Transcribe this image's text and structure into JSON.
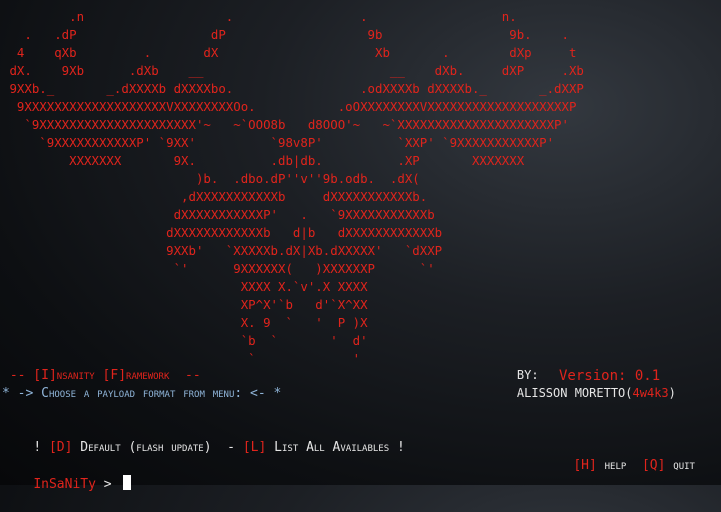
{
  "banner": {
    "art_lines": [
      "         .n                   .                 .                  n.",
      "   .   .dP                  dP                   9b                 9b.    .",
      "  4    qXb         .       dX                     Xb       .        dXp     t",
      " dX.    9Xb      .dXb    __                         __    dXb.     dXP     .Xb",
      " 9XXb._       _.dXXXXb dXXXXbo.                 .odXXXXb dXXXXb._       _.dXXP",
      "  9XXXXXXXXXXXXXXXXXXXVXXXXXXXXOo.           .oOXXXXXXXXVXXXXXXXXXXXXXXXXXXXP",
      "   `9XXXXXXXXXXXXXXXXXXXXX'~   ~`OOO8b   d8OOO'~   ~`XXXXXXXXXXXXXXXXXXXXXP'",
      "     `9XXXXXXXXXXXP' `9XX'          `98v8P'          `XXP' `9XXXXXXXXXXXP'",
      "         XXXXXXX       9X.          .db|db.          .XP       XXXXXXX",
      "                          )b.  .dbo.dP''v''9b.odb.  .dX(",
      "                        ,dXXXXXXXXXXXb     dXXXXXXXXXXXb.",
      "                       dXXXXXXXXXXXP'   .   `9XXXXXXXXXXXb",
      "                      dXXXXXXXXXXXXb   d|b   dXXXXXXXXXXXXb",
      "                      9XXb'   `XXXXXb.dX|Xb.dXXXXX'   `dXXP",
      "                       `'      9XXXXXX(   )XXXXXXP      `'",
      "                                XXXX X.`v'.X XXXX",
      "                                XP^X'`b   d'`X^XX",
      "                                X. 9  `   '  P )X",
      "                                `b  `       '  d'",
      "                                 `             '"
    ],
    "author_prefix": "BY:",
    "author_name": "ALISSON MORETTO",
    "author_paren_open": "(",
    "author_handle": "4w4k3",
    "author_paren_close": ")",
    "version": "Version: 0.1"
  },
  "framework_title": " -- [I]nsanity [F]ramework  --",
  "menu": {
    "prompt_line": "* -> Choose a payload format from menu: <- *",
    "options_prefix": "! ",
    "opt_default_key": "[D]",
    "opt_default_label": " Default (flash update)",
    "separator": "  - ",
    "opt_list_key": "[L]",
    "opt_list_label": " List All Availables !",
    "help_key": "[H]",
    "help_label": " help",
    "quit_key": "[Q]",
    "quit_label": " quit"
  },
  "shell": {
    "prompt": "InSaNiTy",
    "arrow": " > ",
    "input_value": ""
  },
  "colors": {
    "accent_red": "#e0241c",
    "text_white": "#e6e6e6",
    "menu_blue": "#8fb4d8",
    "background": "#0d0f12"
  }
}
